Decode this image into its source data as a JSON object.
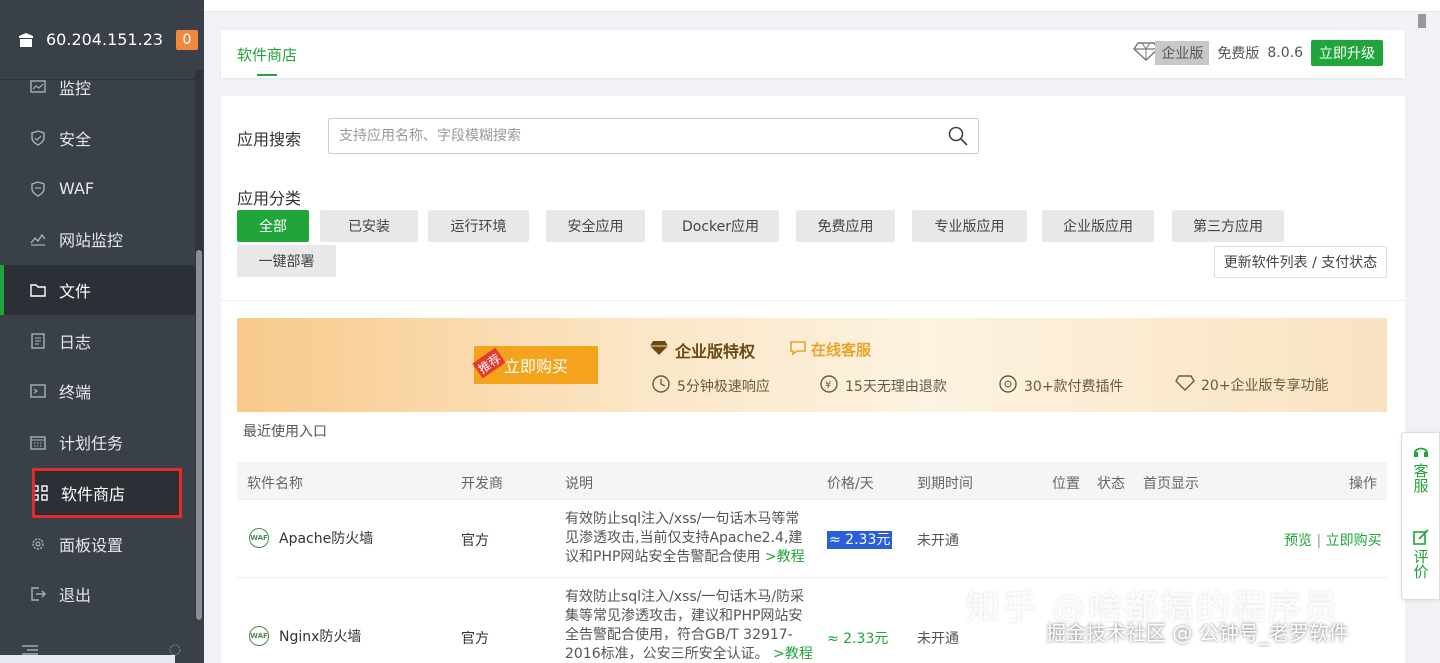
{
  "sidebar": {
    "server_ip": "60.204.151.23",
    "badge_count": "0",
    "items": [
      {
        "label": "监控",
        "icon": "monitor-icon"
      },
      {
        "label": "安全",
        "icon": "shield-icon"
      },
      {
        "label": "WAF",
        "icon": "waf-shield-icon"
      },
      {
        "label": "网站监控",
        "icon": "site-monitor-icon"
      },
      {
        "label": "文件",
        "icon": "folder-icon"
      },
      {
        "label": "日志",
        "icon": "log-icon"
      },
      {
        "label": "终端",
        "icon": "terminal-icon"
      },
      {
        "label": "计划任务",
        "icon": "calendar-icon"
      },
      {
        "label": "软件商店",
        "icon": "grid-icon"
      },
      {
        "label": "面板设置",
        "icon": "gear-icon"
      },
      {
        "label": "退出",
        "icon": "logout-icon"
      }
    ],
    "active_index": 4,
    "highlight_index": 8
  },
  "header": {
    "tab_label": "软件商店",
    "edition_label": "企业版",
    "free_label": "免费版",
    "version": "8.0.6",
    "upgrade_label": "立即升级"
  },
  "search": {
    "label": "应用搜索",
    "placeholder": "支持应用名称、字段模糊搜索"
  },
  "categories": {
    "label": "应用分类",
    "items": [
      "全部",
      "已安装",
      "运行环境",
      "安全应用",
      "Docker应用",
      "免费应用",
      "专业版应用",
      "企业版应用",
      "第三方应用",
      "一键部署"
    ],
    "active": "全部",
    "refresh_label": "更新软件列表 / 支付状态"
  },
  "banner": {
    "tag": "推荐",
    "buy_label": "立即购买",
    "title": "企业版特权",
    "online_service": "在线客服",
    "features": [
      "5分钟极速响应",
      "15天无理由退款",
      "30+款付费插件",
      "20+企业版专享功能"
    ]
  },
  "recent_label": "最近使用入口",
  "table": {
    "headers": [
      "软件名称",
      "开发商",
      "说明",
      "价格/天",
      "到期时间",
      "位置",
      "状态",
      "首页显示",
      "操作"
    ],
    "rows": [
      {
        "name": "Apache防火墙",
        "developer": "官方",
        "desc": "有效防止sql注入/xss/一句话木马等常见渗透攻击,当前仅支持Apache2.4,建议和PHP网站安全告警配合使用",
        "desc_link": ">教程",
        "desc_extra": "",
        "price": "≈ 2.33元",
        "expire": "未开通",
        "ops": [
          "预览",
          "立即购买"
        ]
      },
      {
        "name": "Nginx防火墙",
        "developer": "官方",
        "desc": "有效防止sql注入/xss/一句话木马/防采集等常见渗透攻击，建议和PHP网站安全告警配合使用，符合GB/T 32917-2016标准，公安三所安全认证。",
        "desc_link": ">教程",
        "desc_extra": ">申",
        "price": "≈ 2.33元",
        "expire": "未开通",
        "ops": []
      }
    ]
  },
  "float_service": {
    "service_label": "客服",
    "review_label": "评价"
  },
  "watermark": {
    "line1": "知乎 @啥都搞的程序员",
    "line2": "掘金技术社区 @ 公钟号_老罗软件"
  }
}
